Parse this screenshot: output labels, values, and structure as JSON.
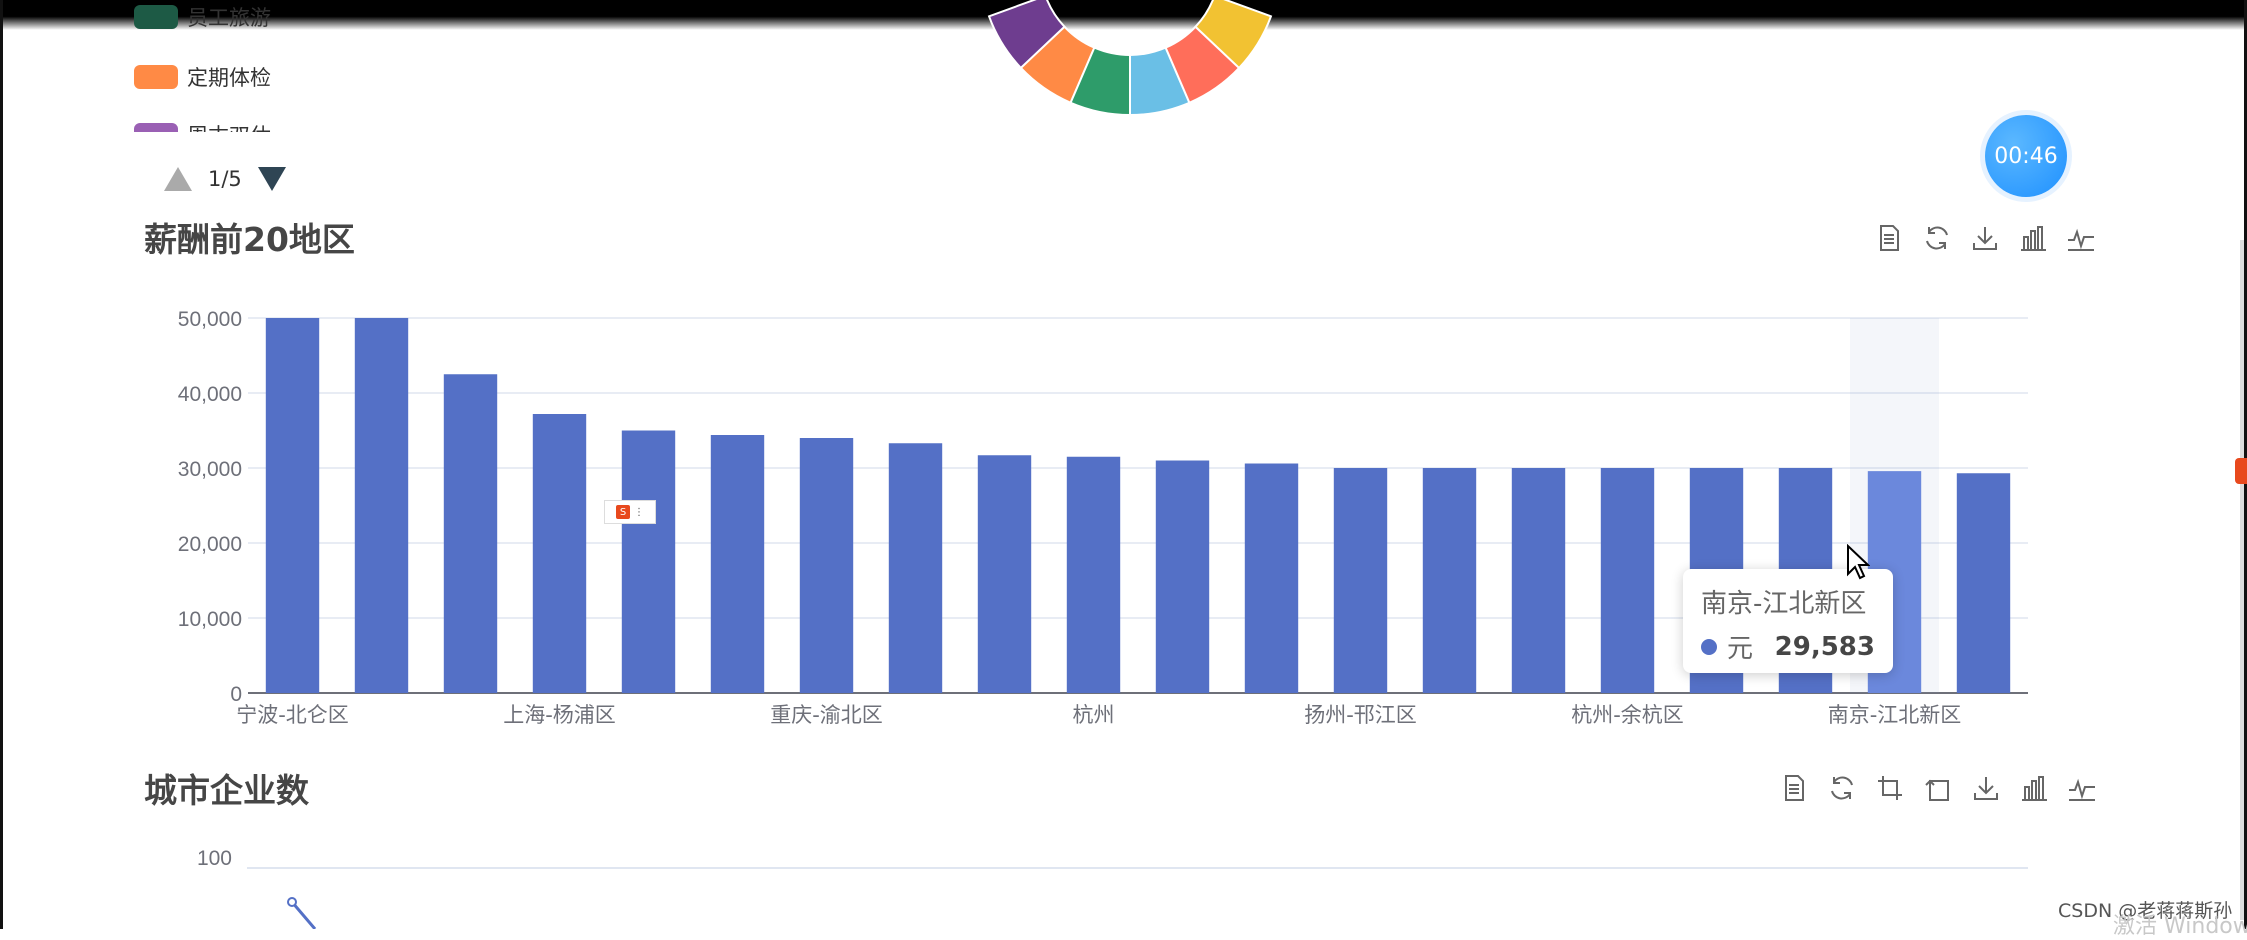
{
  "legend": {
    "items": [
      {
        "label": "员工旅游",
        "color": "#1d5a45"
      },
      {
        "label": "定期体检",
        "color": "#ff8a45"
      },
      {
        "label": "周末双休",
        "color": "#9a60b4"
      }
    ],
    "pager": "1/5"
  },
  "donut": {
    "colors": [
      "#6e3d8f",
      "#ff8a45",
      "#2e9c6a",
      "#6abfe6",
      "#ff6e5a",
      "#f2c232"
    ]
  },
  "timer": "00:46",
  "salary_chart": {
    "title": "薪酬前20地区",
    "toolbox": [
      "data-view-icon",
      "restore-icon",
      "save-image-icon",
      "bar-type-icon",
      "line-type-icon"
    ],
    "tooltip": {
      "name": "南京-江北新区",
      "series": "元",
      "value": "29,583"
    }
  },
  "city_chart": {
    "title": "城市企业数",
    "toolbox": [
      "data-view-icon",
      "restore-icon",
      "zoom-icon",
      "zoom-back-icon",
      "save-image-icon",
      "bar-type-icon",
      "line-type-icon"
    ],
    "y_tick": "100"
  },
  "watermark": "CSDN @老蒋蒋斯孙",
  "activate_text": "激活 Windows",
  "chart_data": [
    {
      "type": "bar",
      "title": "薪酬前20地区",
      "categories": [
        "宁波-北仑区",
        "",
        "",
        "上海-杨浦区",
        "",
        "",
        "重庆-渝北区",
        "",
        "",
        "杭州",
        "",
        "",
        "扬州-邗江区",
        "",
        "",
        "杭州-余杭区",
        "",
        "",
        "南京-江北新区",
        ""
      ],
      "series": [
        {
          "name": "元",
          "values": [
            50000,
            50000,
            42500,
            37200,
            35000,
            34400,
            34000,
            33300,
            31700,
            31500,
            31000,
            30600,
            30000,
            30000,
            30000,
            30000,
            30000,
            30000,
            29583,
            29300
          ]
        }
      ],
      "ylim": [
        0,
        50000
      ],
      "yticks": [
        "0",
        "10,000",
        "20,000",
        "30,000",
        "40,000",
        "50,000"
      ],
      "highlight_index": 18,
      "color": "#5470c6",
      "highlight_color": "#6b88dc",
      "grid": true
    },
    {
      "type": "line",
      "title": "城市企业数",
      "yticks": [
        "100"
      ]
    }
  ]
}
